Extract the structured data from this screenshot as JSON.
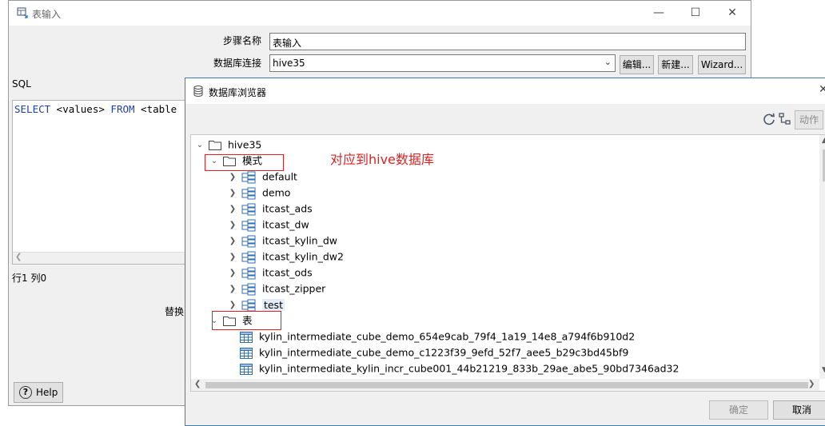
{
  "main_window": {
    "title": "表输入",
    "step_name_label": "步骤名称",
    "step_name_value": "表输入",
    "db_conn_label": "数据库连接",
    "db_conn_value": "hive35",
    "edit_label": "编辑...",
    "new_label": "新建...",
    "wizard_label": "Wizard...",
    "sql_label": "SQL",
    "sql_keyword_select": "SELECT",
    "sql_values": " <values> ",
    "sql_keyword_from": "FROM",
    "sql_table": " <table",
    "position_label": "行1 列0",
    "replace_label": "替换",
    "help_label": "Help"
  },
  "browser": {
    "title": "数据库浏览器",
    "action_label": "动作",
    "ok_label": "确定",
    "cancel_label": "取消",
    "annotation": "对应到hive数据库",
    "tree": {
      "root": "hive35",
      "schema_folder": "模式",
      "schemas": [
        "default",
        "demo",
        "itcast_ads",
        "itcast_dw",
        "itcast_kylin_dw",
        "itcast_kylin_dw2",
        "itcast_ods",
        "itcast_zipper",
        "test"
      ],
      "table_folder": "表",
      "tables": [
        "kylin_intermediate_cube_demo_654e9cab_79f4_1a19_14e8_a794f6b910d2",
        "kylin_intermediate_cube_demo_c1223f39_9efd_52f7_aee5_b29c3bd45bf9",
        "kylin_intermediate_kylin_incr_cube001_44b21219_833b_29ae_abe5_90bd7346ad32"
      ]
    }
  },
  "colors": {
    "annotation": "#e02020",
    "keyword": "#1a3fb0",
    "dialog_border": "#3c7fb1"
  }
}
